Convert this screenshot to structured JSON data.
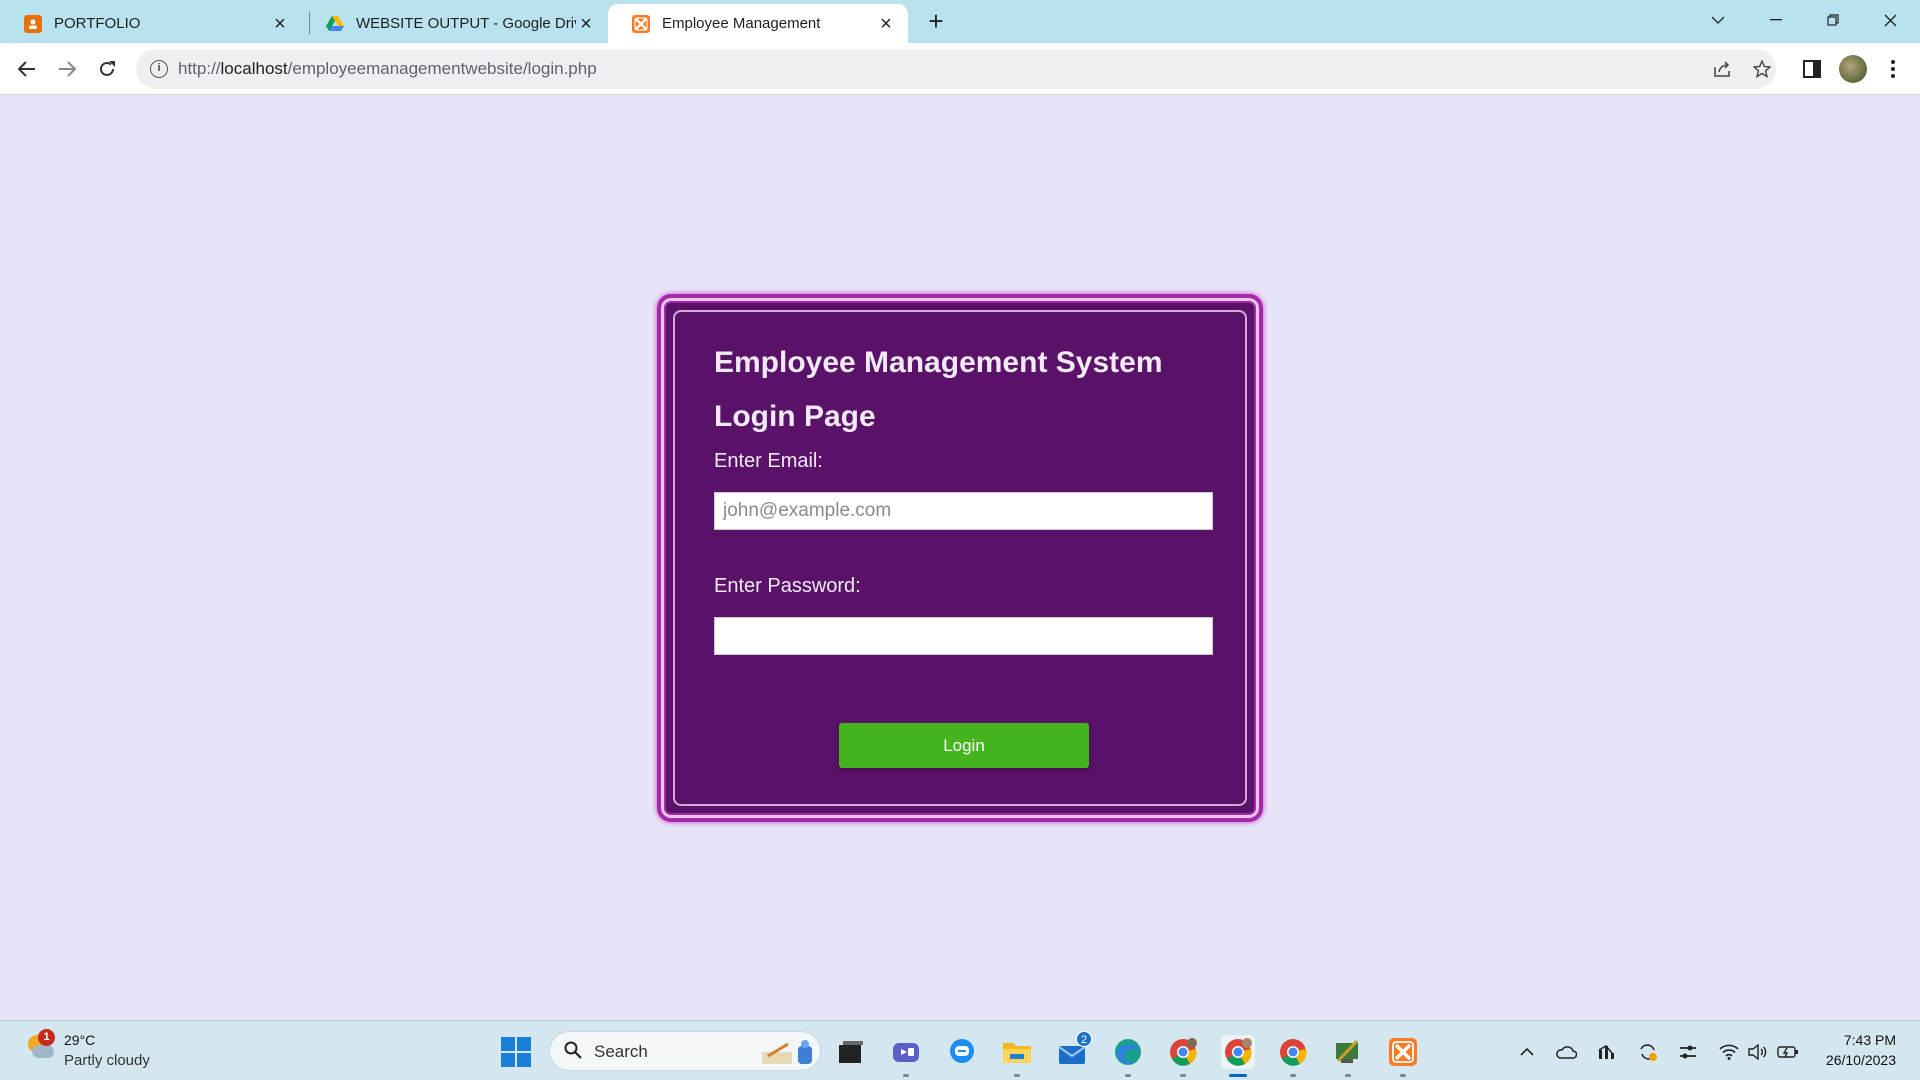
{
  "browser": {
    "tabs": [
      {
        "title": "PORTFOLIO",
        "favicon": "portfolio-favicon",
        "active": false
      },
      {
        "title": "WEBSITE OUTPUT - Google Drive",
        "favicon": "google-drive-favicon",
        "active": false
      },
      {
        "title": "Employee Management",
        "favicon": "xampp-favicon",
        "active": true
      }
    ],
    "url_prefix": "http://",
    "url_host": "localhost",
    "url_path": "/employeemanagementwebsite/login.php",
    "colors": {
      "tabbar": "#b9e2ef",
      "page_bg": "#e8e4f8"
    }
  },
  "login": {
    "title": "Employee Management System",
    "subtitle": "Login Page",
    "email_label": "Enter Email:",
    "email_placeholder": "john@example.com",
    "email_value": "",
    "password_label": "Enter Password:",
    "password_value": "",
    "button_label": "Login",
    "colors": {
      "card": "#5a1168",
      "border": "#a52aa8",
      "button": "#45b51d"
    }
  },
  "taskbar": {
    "weather_badge": "1",
    "temperature": "29°C",
    "condition": "Partly cloudy",
    "search_label": "Search",
    "mail_badge": "2",
    "time": "7:43 PM",
    "date": "26/10/2023",
    "apps": [
      "task-view-icon",
      "teams-icon",
      "chat-icon",
      "file-explorer-icon",
      "mail-icon",
      "edge-icon",
      "chrome-profile-icon",
      "chrome-active-icon",
      "chrome-icon",
      "xampp-tools-icon",
      "xampp-icon"
    ]
  }
}
